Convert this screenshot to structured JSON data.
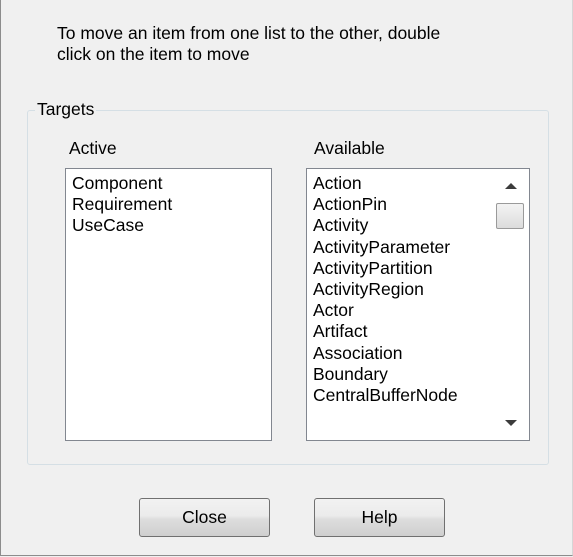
{
  "instructions": {
    "line1": "To move an item from one list to the other, double",
    "line2": "click on the item to move"
  },
  "targets": {
    "legend": "Targets",
    "active": {
      "label": "Active",
      "items": [
        "Component",
        "Requirement",
        "UseCase"
      ]
    },
    "available": {
      "label": "Available",
      "items": [
        "Action",
        "ActionPin",
        "Activity",
        "ActivityParameter",
        "ActivityPartition",
        "ActivityRegion",
        "Actor",
        "Artifact",
        "Association",
        "Boundary",
        "CentralBufferNode"
      ]
    }
  },
  "buttons": {
    "close": "Close",
    "help": "Help"
  },
  "icons": {
    "scroll_up": "scroll-up-arrow-icon",
    "scroll_down": "scroll-down-arrow-icon"
  }
}
